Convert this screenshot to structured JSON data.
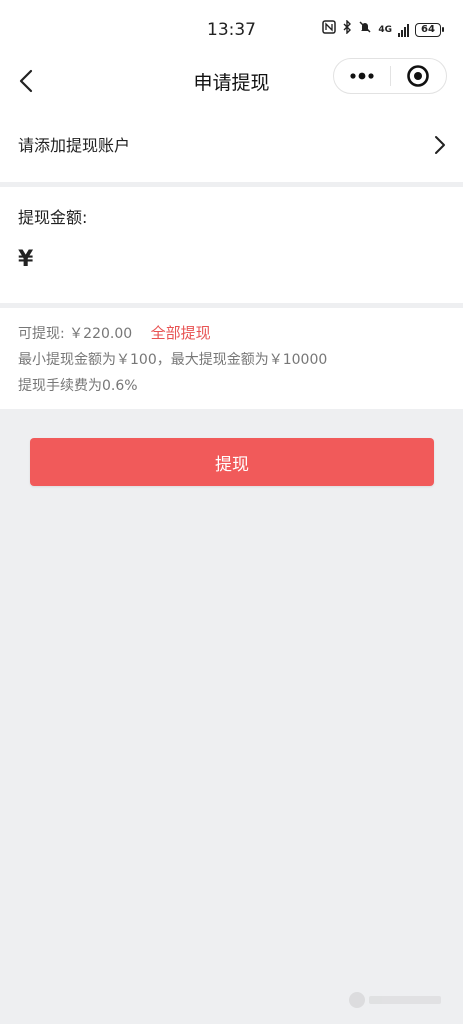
{
  "status_bar": {
    "time": "13:37",
    "network": "4G",
    "battery": "64"
  },
  "nav": {
    "title": "申请提现",
    "more_label": "•••"
  },
  "account": {
    "label": "请添加提现账户"
  },
  "amount": {
    "label": "提现金额:",
    "currency_symbol": "¥",
    "value": "",
    "placeholder": ""
  },
  "info": {
    "available_label": "可提现:",
    "available_value": "￥220.00",
    "withdraw_all_label": "全部提现",
    "limits_text": "最小提现金额为￥100，最大提现金额为￥10000",
    "fee_text": "提现手续费为0.6%"
  },
  "submit": {
    "label": "提现"
  },
  "colors": {
    "accent": "#f15a5a",
    "link": "#e85353",
    "background": "#eeeff1"
  }
}
